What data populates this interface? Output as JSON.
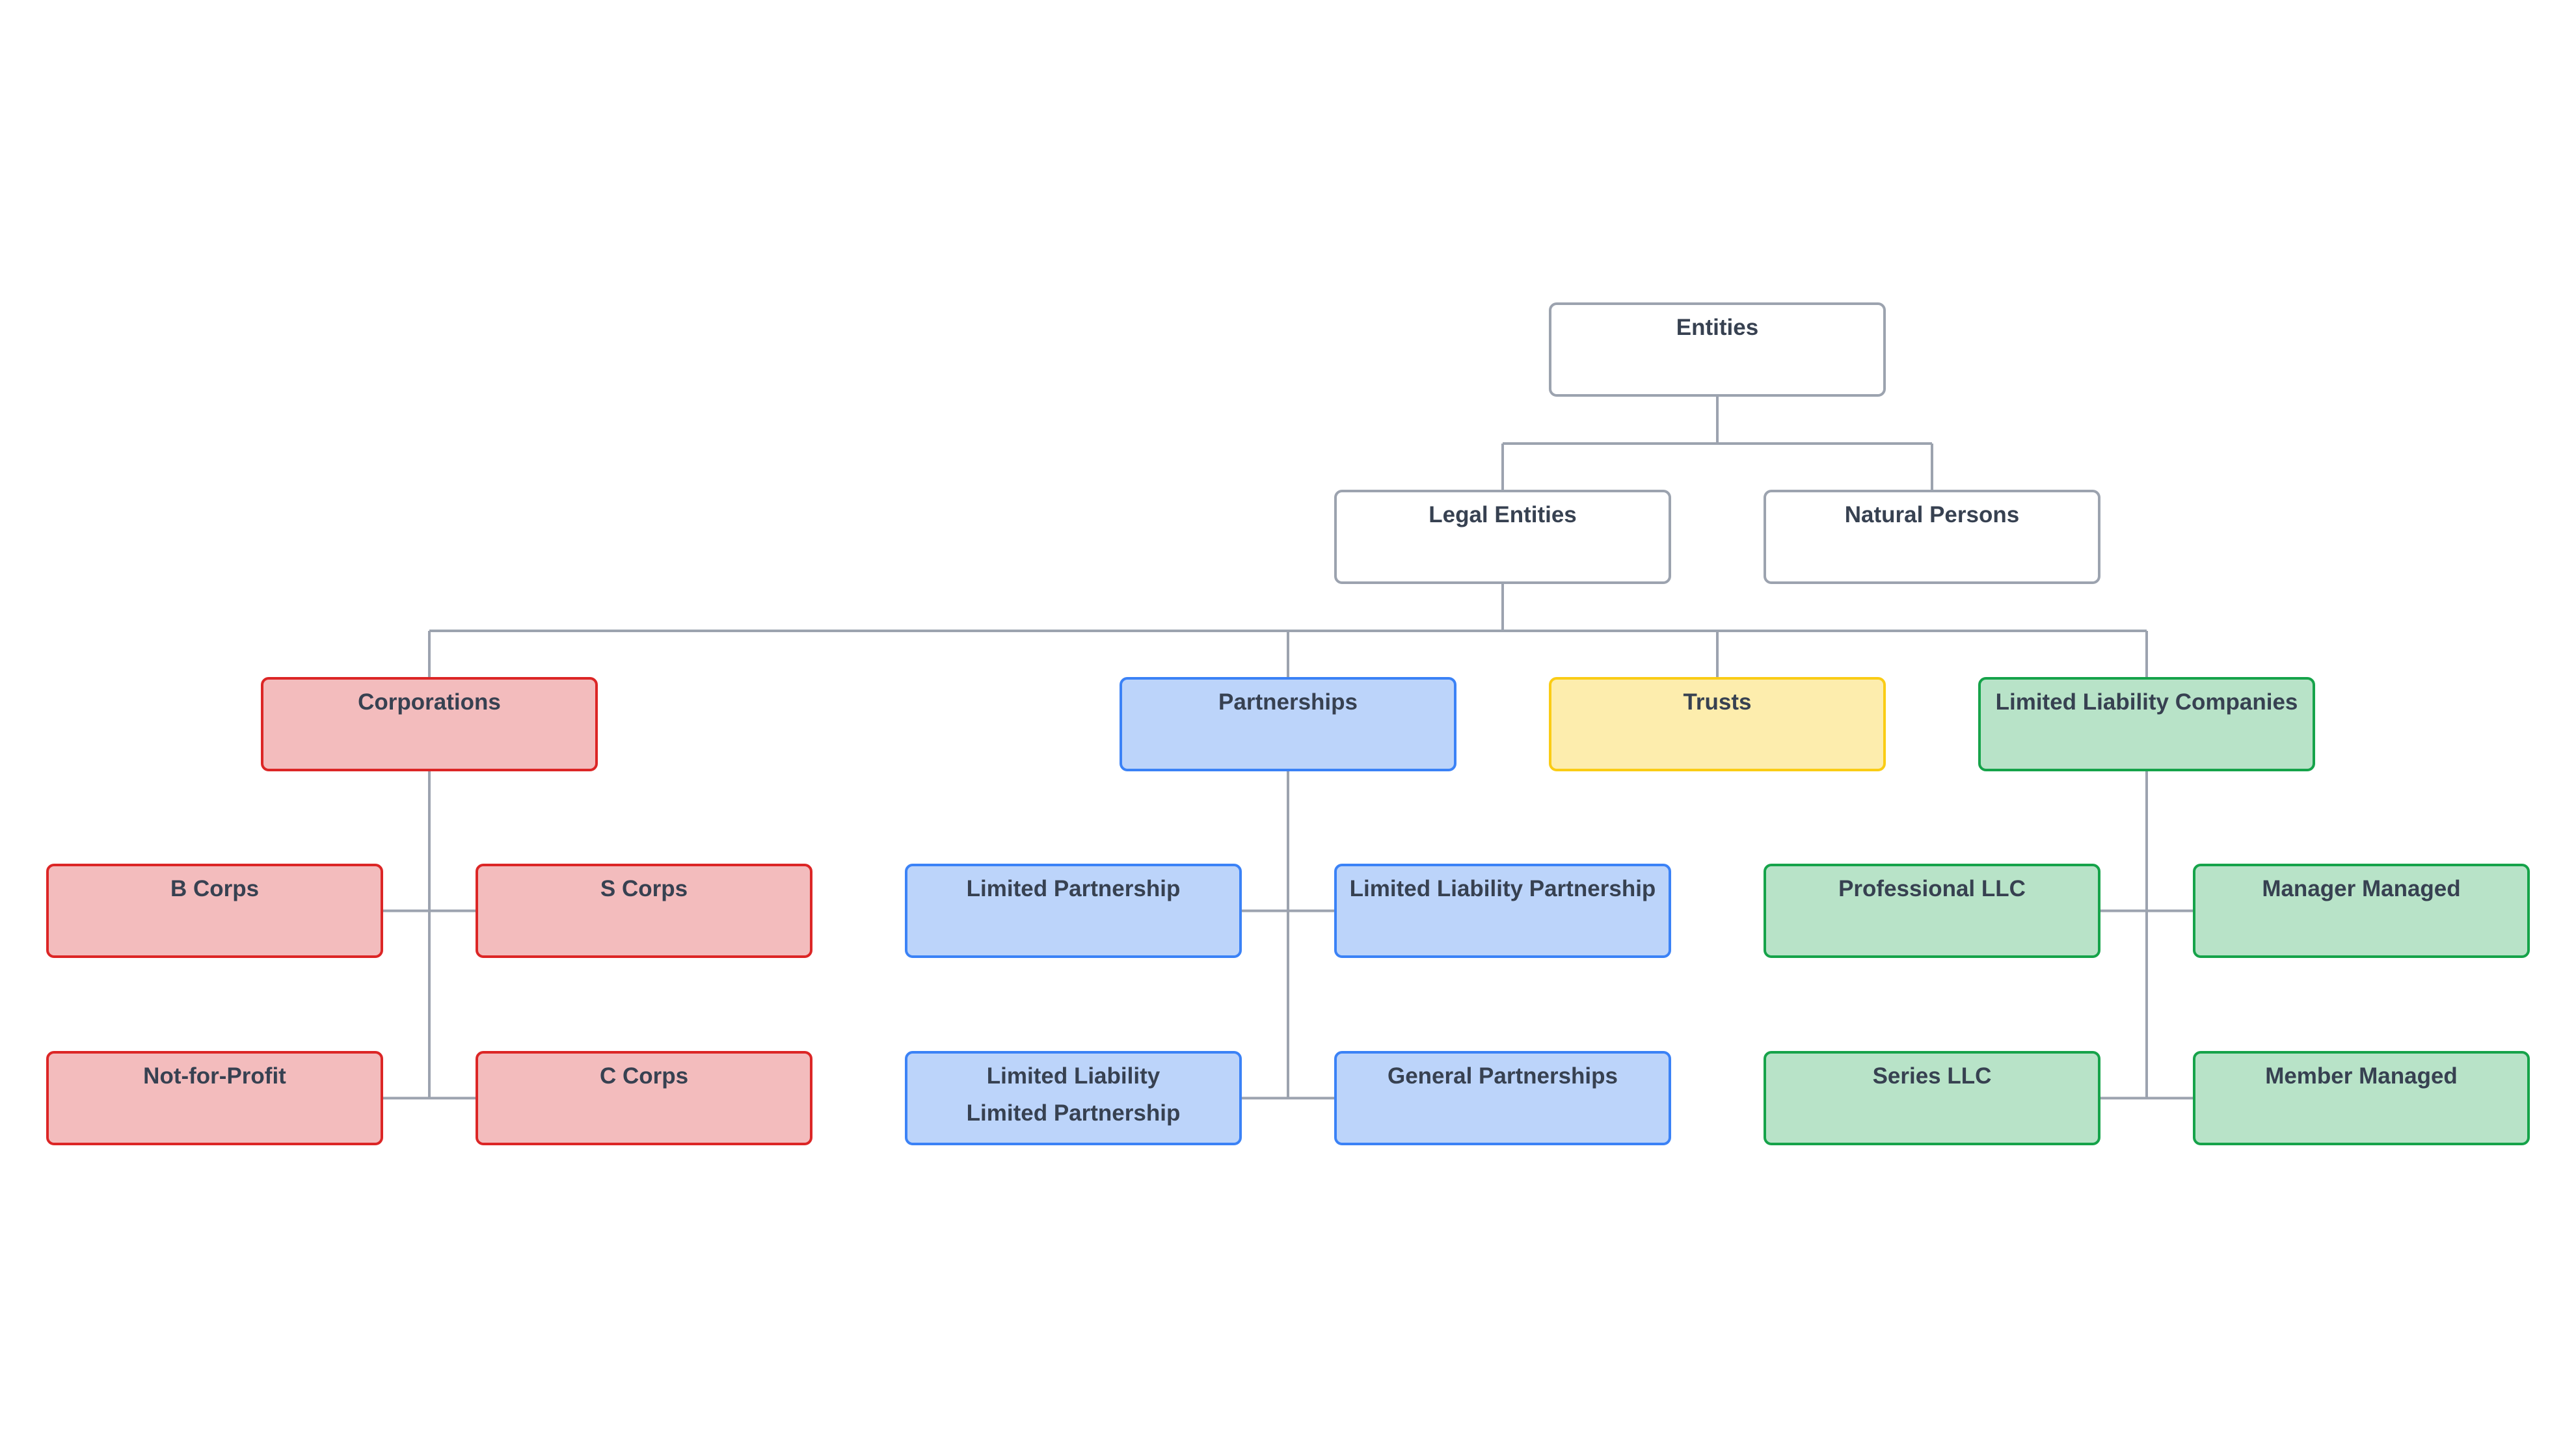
{
  "diagram": {
    "type": "org-chart",
    "title": "Entities",
    "colors": {
      "connector": "#9ca3af",
      "text": "#374151",
      "gray": {
        "fill": "#ffffff",
        "border": "#9ca3af"
      },
      "red": {
        "fill": "#f3bcbd",
        "border": "#dc2626"
      },
      "blue": {
        "fill": "#bcd4fa",
        "border": "#3b82f6"
      },
      "yellow": {
        "fill": "#fdedad",
        "border": "#facc15"
      },
      "green": {
        "fill": "#b8e3c8",
        "border": "#16a34a"
      }
    },
    "nodes": [
      {
        "id": "entities",
        "label": "Entities",
        "parent": null,
        "color": "gray"
      },
      {
        "id": "legal-entities",
        "label": "Legal Entities",
        "parent": "entities",
        "color": "gray"
      },
      {
        "id": "natural-persons",
        "label": "Natural Persons",
        "parent": "entities",
        "color": "gray"
      },
      {
        "id": "corporations",
        "label": "Corporations",
        "parent": "legal-entities",
        "color": "red"
      },
      {
        "id": "partnerships",
        "label": "Partnerships",
        "parent": "legal-entities",
        "color": "blue"
      },
      {
        "id": "trusts",
        "label": "Trusts",
        "parent": "legal-entities",
        "color": "yellow"
      },
      {
        "id": "llcs",
        "label": "Limited Liability Companies",
        "parent": "legal-entities",
        "color": "green"
      },
      {
        "id": "b-corps",
        "label": "B Corps",
        "parent": "corporations",
        "color": "red"
      },
      {
        "id": "s-corps",
        "label": "S Corps",
        "parent": "corporations",
        "color": "red"
      },
      {
        "id": "not-for-profit",
        "label": "Not-for-Profit",
        "parent": "corporations",
        "color": "red"
      },
      {
        "id": "c-corps",
        "label": "C Corps",
        "parent": "corporations",
        "color": "red"
      },
      {
        "id": "limited-partnership",
        "label": "Limited Partnership",
        "parent": "partnerships",
        "color": "blue"
      },
      {
        "id": "llp",
        "label": "Limited Liability Partnership",
        "parent": "partnerships",
        "color": "blue"
      },
      {
        "id": "lllp",
        "label": "Limited Liability\nLimited Partnership",
        "parent": "partnerships",
        "color": "blue"
      },
      {
        "id": "general-partnerships",
        "label": "General Partnerships",
        "parent": "partnerships",
        "color": "blue"
      },
      {
        "id": "professional-llc",
        "label": "Professional LLC",
        "parent": "llcs",
        "color": "green"
      },
      {
        "id": "manager-managed",
        "label": "Manager Managed",
        "parent": "llcs",
        "color": "green"
      },
      {
        "id": "series-llc",
        "label": "Series LLC",
        "parent": "llcs",
        "color": "green"
      },
      {
        "id": "member-managed",
        "label": "Member Managed",
        "parent": "llcs",
        "color": "green"
      }
    ]
  }
}
